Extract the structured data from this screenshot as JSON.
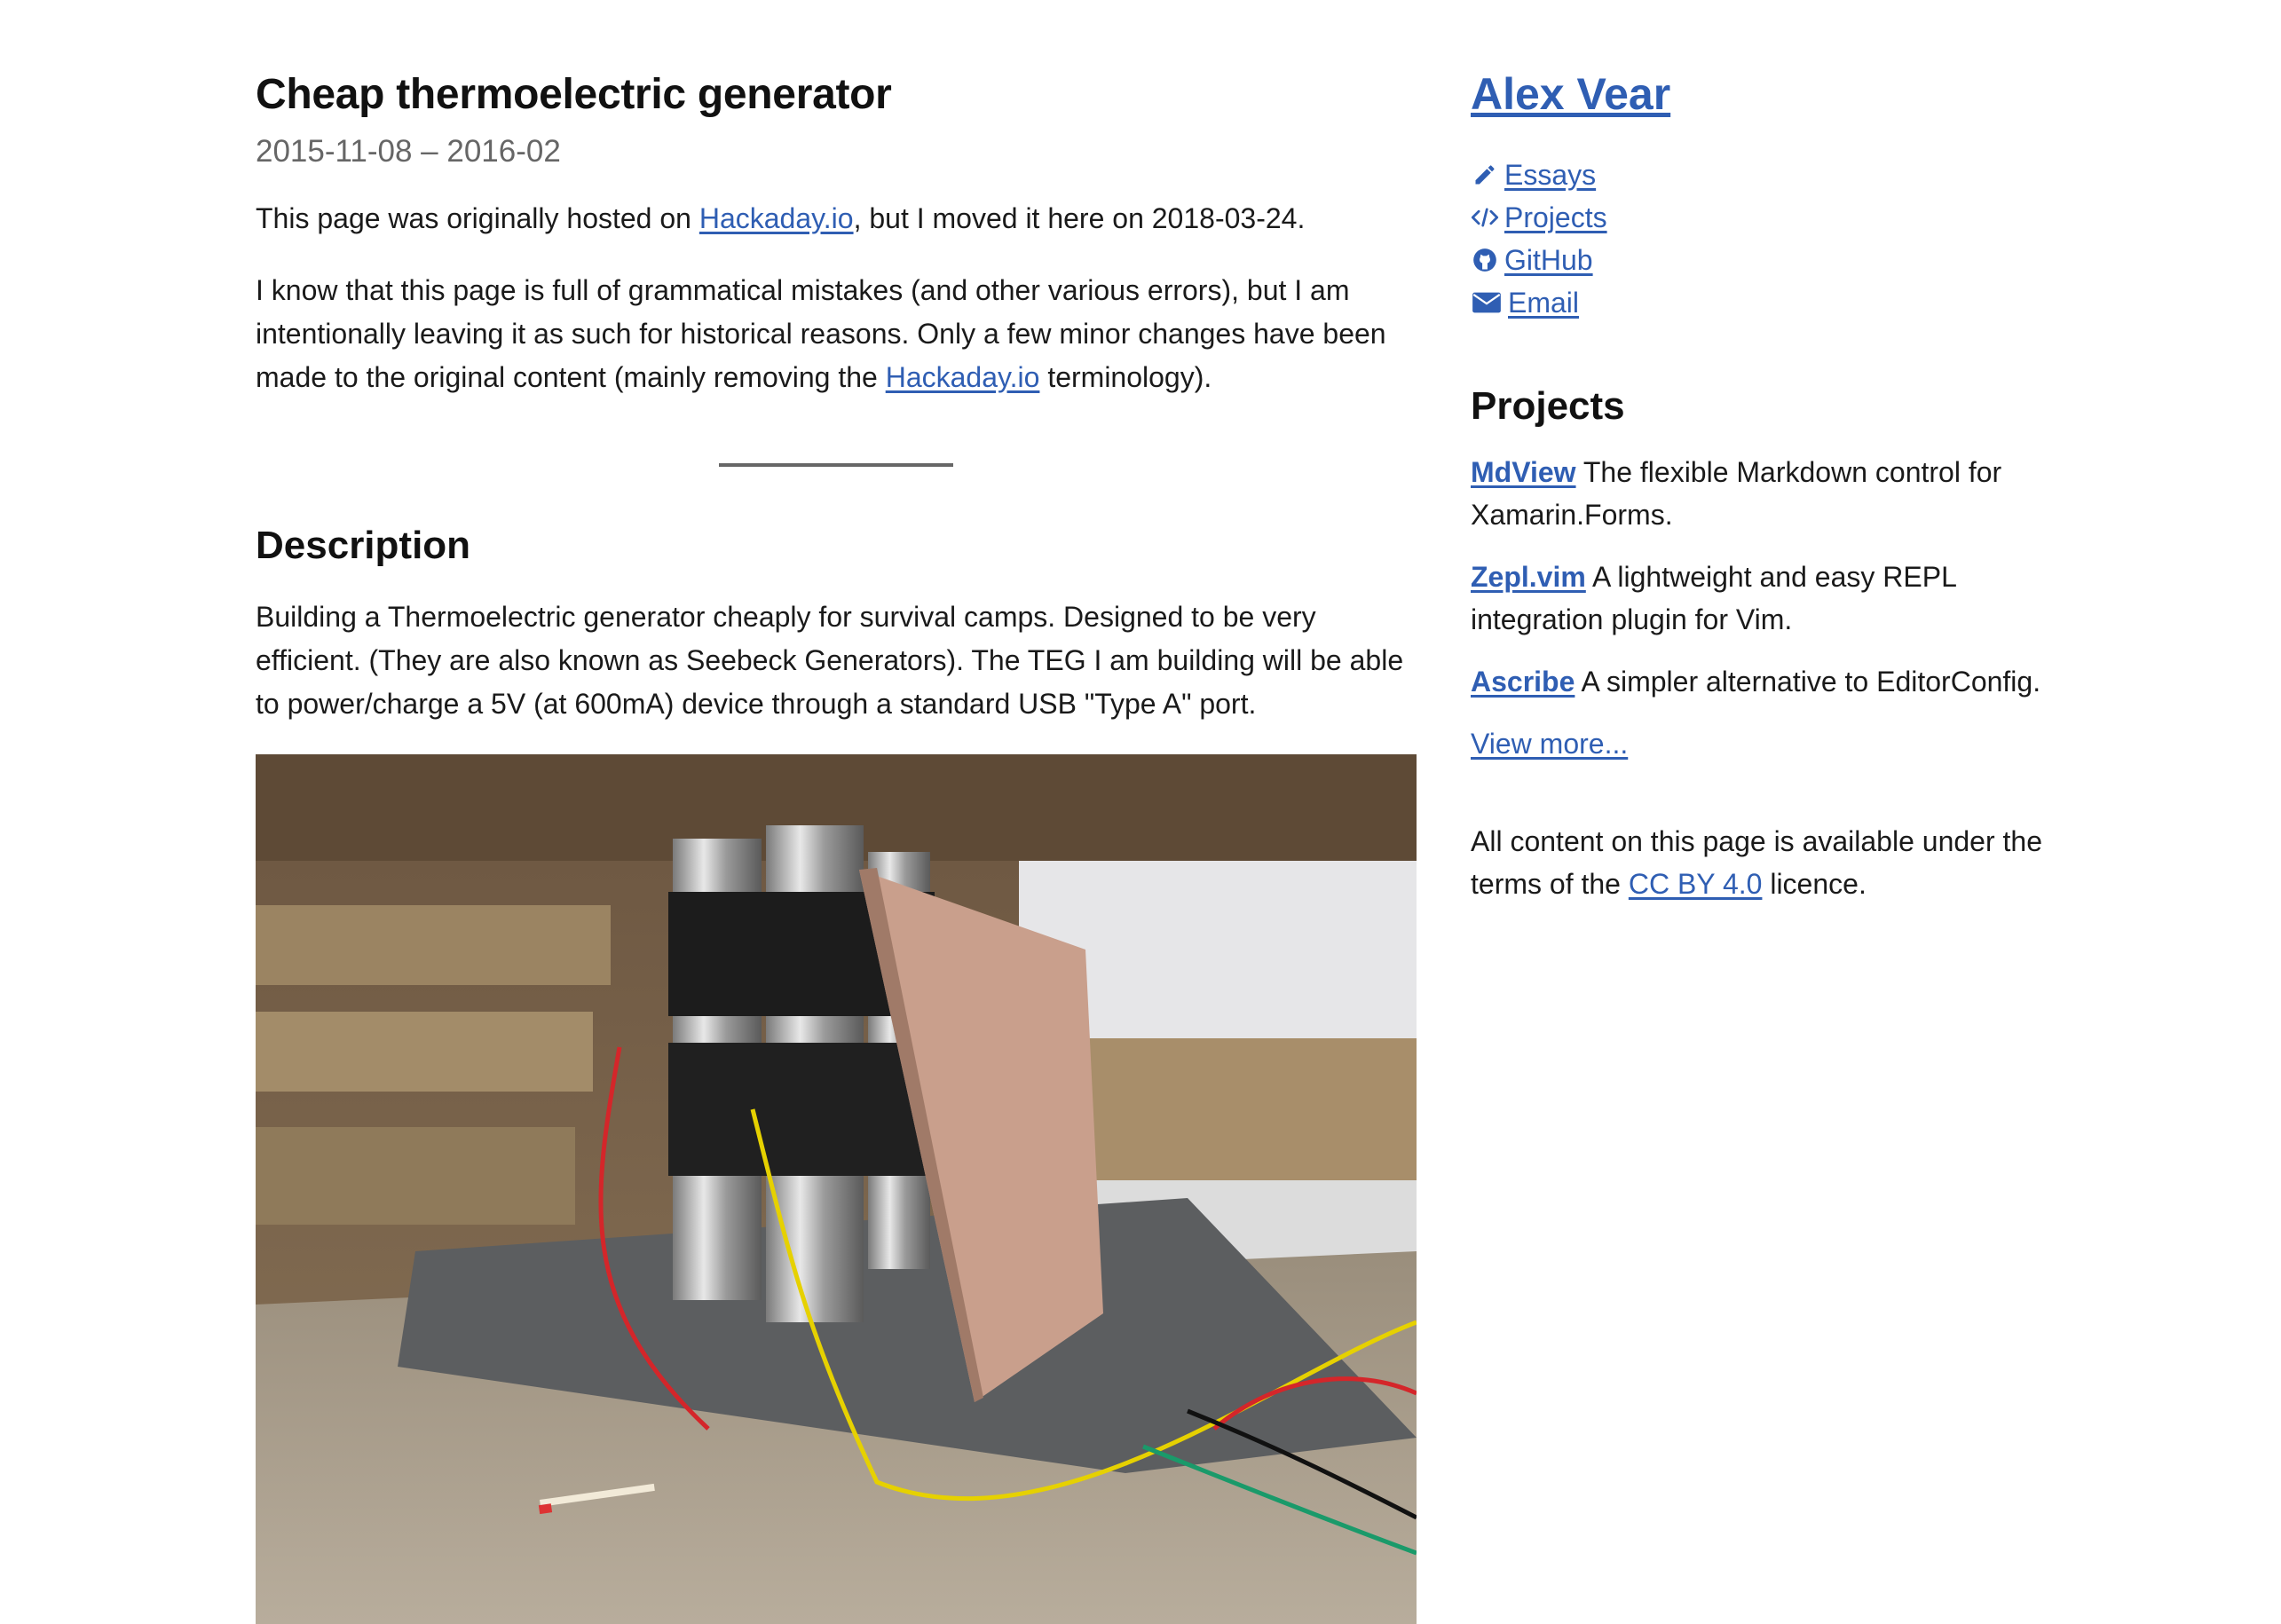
{
  "article": {
    "title": "Cheap thermoelectric generator",
    "dates": "2015-11-08 – 2016-02",
    "intro1": {
      "before": "This page was originally hosted on ",
      "link": "Hackaday.io",
      "after": ", but I moved it here on 2018-03-24."
    },
    "intro2": {
      "before": "I know that this page is full of grammatical mistakes (and other various errors), but I am intentionally leaving it as such for historical reasons.  Only a few minor changes have been made to the original content (mainly removing the ",
      "link": "Hackaday.io",
      "after": " terminology)."
    },
    "section_heading": "Description",
    "description": "Building a Thermoelectric generator cheaply for survival camps.  Designed to be very efficient.  (They are also known as Seebeck Generators).  The TEG I am building will be able to power/charge a 5V (at 600mA) device through a standard USB \"Type A\" port."
  },
  "sidebar": {
    "author": "Alex Vear",
    "nav": [
      {
        "label": "Essays",
        "icon": "pencil-icon"
      },
      {
        "label": "Projects",
        "icon": "code-icon"
      },
      {
        "label": "GitHub",
        "icon": "github-icon"
      },
      {
        "label": "Email",
        "icon": "envelope-icon"
      }
    ],
    "projects_heading": "Projects",
    "projects": [
      {
        "name": "MdView",
        "desc": " The flexible Markdown control for Xamarin.Forms."
      },
      {
        "name": "Zepl.vim",
        "desc": " A lightweight and easy REPL integration plugin for Vim."
      },
      {
        "name": "Ascribe",
        "desc": " A simpler alternative to EditorConfig."
      }
    ],
    "view_more": "View more...",
    "footer": {
      "before": "All content on this page is available under the terms of the ",
      "link": "CC BY 4.0",
      "after": " licence."
    }
  },
  "colors": {
    "link": "#2f5eb3",
    "text": "#1a1a1a",
    "muted": "#666666"
  }
}
